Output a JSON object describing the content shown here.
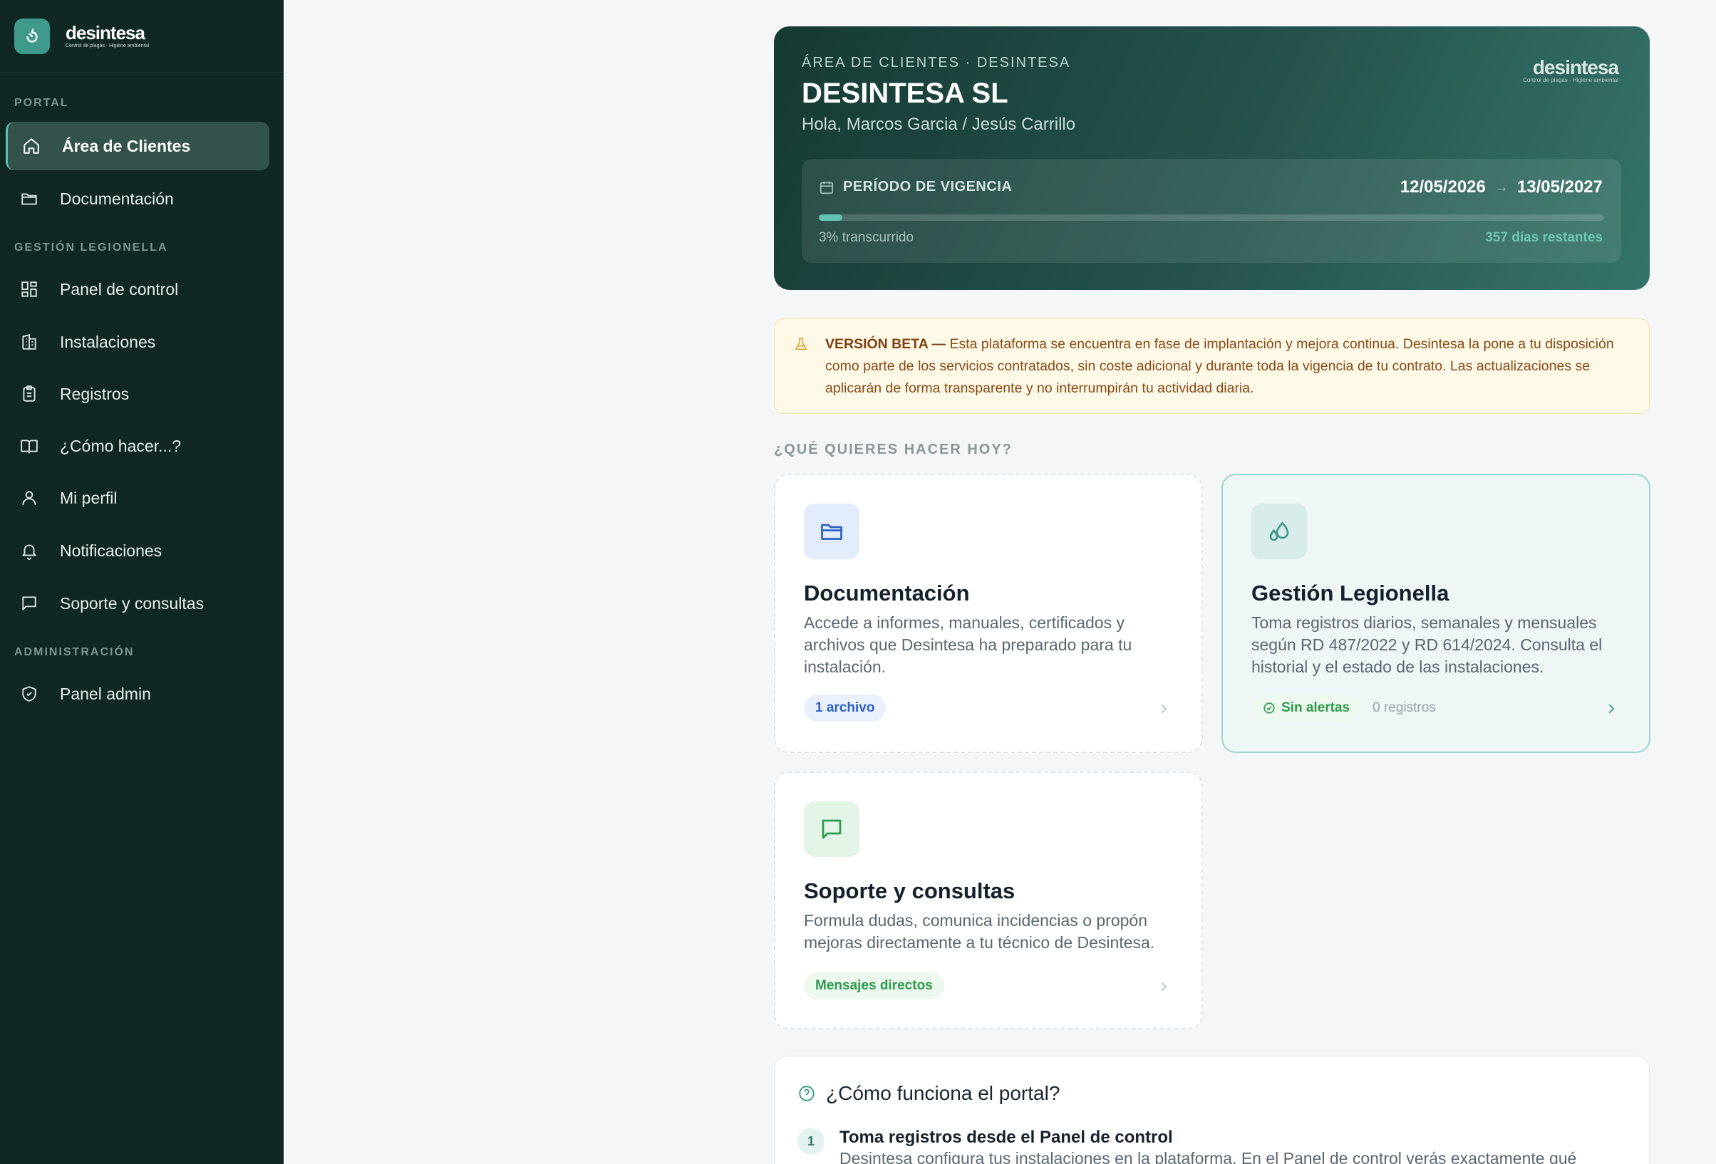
{
  "brand": {
    "name": "desintesa",
    "tagline": "Control de plagas · Higiene ambiental"
  },
  "sidebar": {
    "sections": {
      "portal": "PORTAL",
      "legionella": "GESTIÓN LEGIONELLA",
      "admin": "ADMINISTRACIÓN"
    },
    "items": [
      {
        "label": "Área de Clientes",
        "icon": "home-icon",
        "active": true
      },
      {
        "label": "Documentación",
        "icon": "folder-icon"
      },
      {
        "label": "Panel de control",
        "icon": "dashboard-icon"
      },
      {
        "label": "Instalaciones",
        "icon": "building-icon"
      },
      {
        "label": "Registros",
        "icon": "clipboard-icon"
      },
      {
        "label": "¿Cómo hacer...?",
        "icon": "book-icon"
      },
      {
        "label": "Mi perfil",
        "icon": "user-icon"
      },
      {
        "label": "Notificaciones",
        "icon": "bell-icon"
      },
      {
        "label": "Soporte y consultas",
        "icon": "message-icon"
      },
      {
        "label": "Panel admin",
        "icon": "shield-icon"
      }
    ]
  },
  "hero": {
    "eyebrow": "ÁREA DE CLIENTES · DESINTESA",
    "title": "DESINTESA SL",
    "greeting": "Hola, Marcos Garcia / Jesús Carrillo",
    "vigencia": {
      "label": "PERÍODO DE VIGENCIA",
      "start": "12/05/2026",
      "end": "13/05/2027",
      "progress_percent": 3,
      "elapsed": "3% transcurrido",
      "remaining": "357 días restantes"
    }
  },
  "beta": {
    "title": "VERSIÓN BETA —",
    "text": " Esta plataforma se encuentra en fase de implantación y mejora continua. Desintesa la pone a tu disposición como parte de los servicios contratados, sin coste adicional y durante toda la vigencia de tu contrato. Las actualizaciones se aplicarán de forma transparente y no interrumpirán tu actividad diaria."
  },
  "question": "¿QUÉ QUIERES HACER HOY?",
  "cards": {
    "docs": {
      "title": "Documentación",
      "desc": "Accede a informes, manuales, certificados y archivos que Desintesa ha preparado para tu instalación.",
      "chip": "1 archivo",
      "icon": "folder-icon"
    },
    "legionella": {
      "title": "Gestión Legionella",
      "desc": "Toma registros diarios, semanales y mensuales según RD 487/2022 y RD 614/2024. Consulta el historial y el estado de las instalaciones.",
      "chip": "Sin alertas",
      "extra": "0 registros",
      "icon": "droplets-icon"
    },
    "support": {
      "title": "Soporte y consultas",
      "desc": "Formula dudas, comunica incidencias o propón mejoras directamente a tu técnico de Desintesa.",
      "chip": "Mensajes directos",
      "icon": "message-icon"
    }
  },
  "howto": {
    "title": "¿Cómo funciona el portal?",
    "step1": {
      "num": "1",
      "title": "Toma registros desde el Panel de control",
      "desc": "Desintesa configura tus instalaciones en la plataforma. En el Panel de control verás exactamente qué"
    }
  },
  "colors": {
    "sidebar_bg": "#112723",
    "accent": "#3f9a8c",
    "beta_bg": "#fff9e8",
    "beta_text": "#8a4a17"
  }
}
